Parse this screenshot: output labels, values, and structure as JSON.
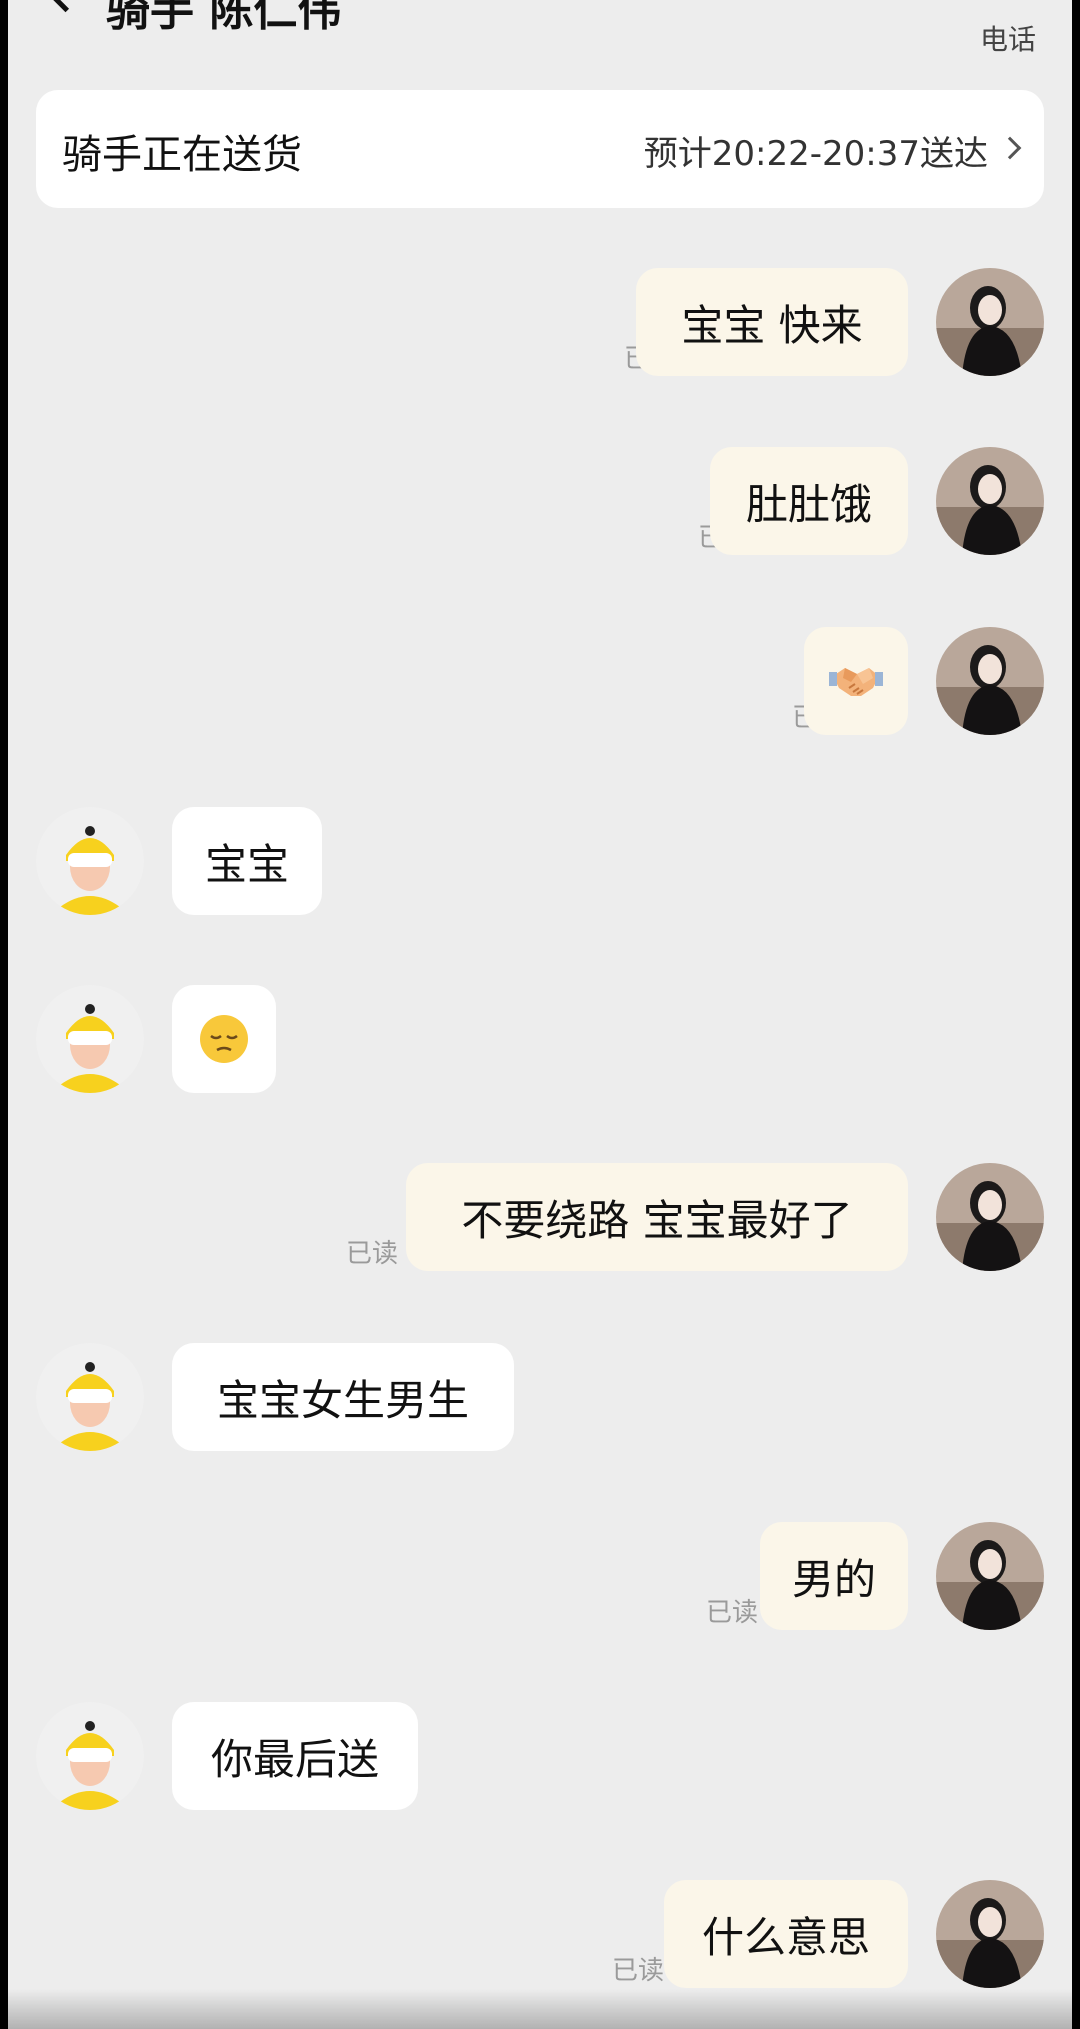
{
  "header": {
    "title": "骑手 陈仁伟",
    "call_label": "电话"
  },
  "status": {
    "text": "骑手正在送货",
    "eta": "预计20:22-20:37送达"
  },
  "messages": [
    {
      "side": "out",
      "text": "宝宝  快来",
      "read": "已读"
    },
    {
      "side": "out",
      "text": "肚肚饿",
      "read": "已读"
    },
    {
      "side": "out",
      "emoji": "handshake-emoji",
      "read": "已读"
    },
    {
      "side": "in",
      "text": "宝宝"
    },
    {
      "side": "in",
      "emoji": "pensive-face-emoji"
    },
    {
      "side": "out",
      "text": "不要绕路  宝宝最好了",
      "read": "已读"
    },
    {
      "side": "in",
      "text": "宝宝女生男生"
    },
    {
      "side": "out",
      "text": "男的",
      "read": "已读"
    },
    {
      "side": "in",
      "text": "你最后送"
    },
    {
      "side": "out",
      "text": "什么意思",
      "read": "已读"
    }
  ],
  "colors": {
    "background": "#ededed",
    "outgoing_bubble": "#fbf6e9",
    "incoming_bubble": "#ffffff",
    "read_text": "#9a9a9a",
    "rider_helmet": "#f7d11e"
  }
}
